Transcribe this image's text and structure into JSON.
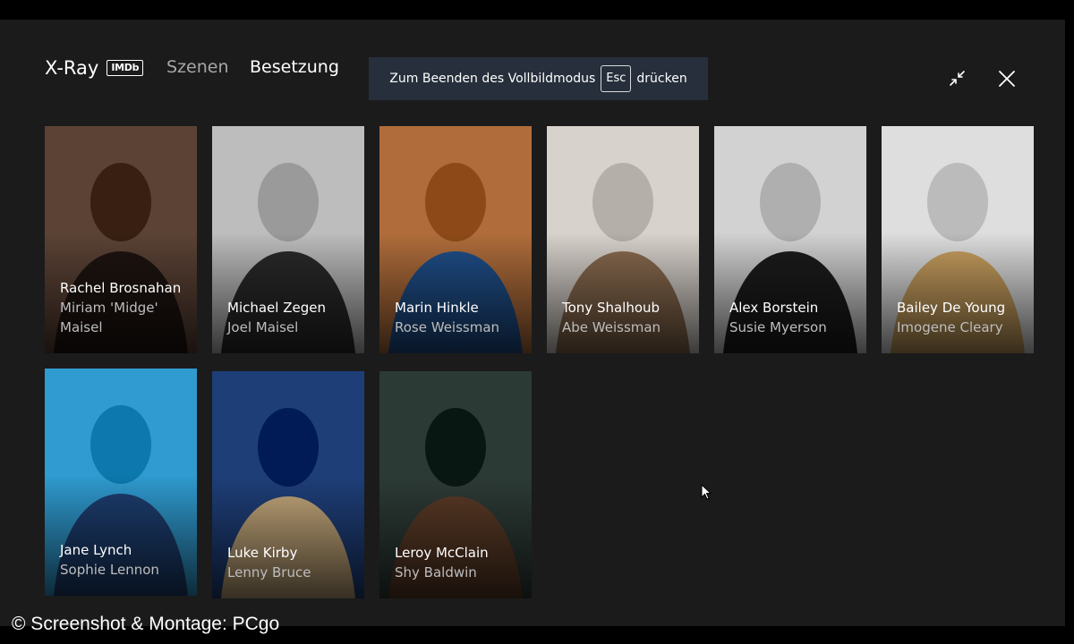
{
  "header": {
    "title": "X-Ray",
    "imdb_badge": "IMDb",
    "tabs": [
      {
        "label": "Szenen",
        "active": false
      },
      {
        "label": "Besetzung",
        "active": true
      }
    ]
  },
  "fullscreen_notice": {
    "text_before": "Zum Beenden des Vollbildmodus",
    "key": "Esc",
    "text_after": "drücken"
  },
  "window_controls": {
    "exit_fullscreen_icon": "collapse-arrows-icon",
    "close_icon": "close-icon"
  },
  "cast": [
    {
      "actor": "Rachel Brosnahan",
      "role": "Miriam 'Midge' Maisel",
      "palette": [
        "#5b4235",
        "#1e1410"
      ]
    },
    {
      "actor": "Michael Zegen",
      "role": "Joel Maisel",
      "palette": [
        "#bdbdbd",
        "#2a2a2a"
      ]
    },
    {
      "actor": "Marin Hinkle",
      "role": "Rose Weissman",
      "palette": [
        "#b06d3b",
        "#1f4f8a"
      ]
    },
    {
      "actor": "Tony Shalhoub",
      "role": "Abe Weissman",
      "palette": [
        "#d8d2cc",
        "#8a6b4f"
      ]
    },
    {
      "actor": "Alex Borstein",
      "role": "Susie Myerson",
      "palette": [
        "#d2d2d2",
        "#1c1c1c"
      ]
    },
    {
      "actor": "Bailey De Young",
      "role": "Imogene Cleary",
      "palette": [
        "#dedede",
        "#c9a05f"
      ]
    },
    {
      "actor": "Jane Lynch",
      "role": "Sophie Lennon",
      "palette": [
        "#2f9bd0",
        "#1d3e70"
      ]
    },
    {
      "actor": "Luke Kirby",
      "role": "Lenny Bruce",
      "palette": [
        "#1e3e78",
        "#c2a67a"
      ]
    },
    {
      "actor": "Leroy McClain",
      "role": "Shy Baldwin",
      "palette": [
        "#2c3a35",
        "#5a3a26"
      ]
    }
  ],
  "watermark": "© Screenshot & Montage: PCgo"
}
